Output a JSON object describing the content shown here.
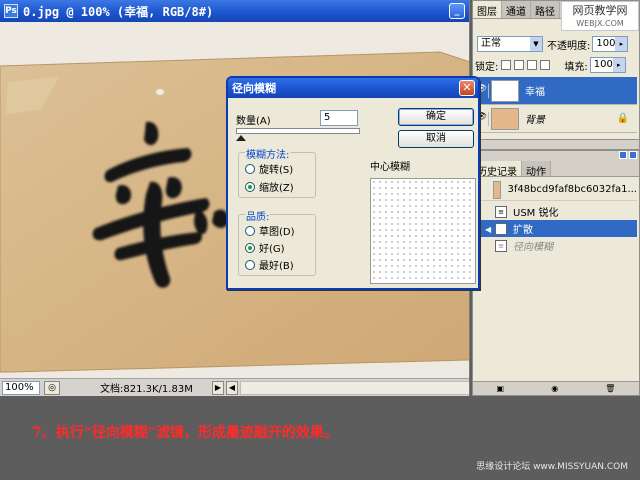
{
  "document": {
    "title": "0.jpg @ 100% (幸福, RGB/8#)",
    "zoom": "100%",
    "status_info": "文档:821.3K/1.83M",
    "canvas_character": "幸"
  },
  "layers_panel": {
    "tabs": [
      "图层",
      "通道",
      "路径"
    ],
    "blend_mode": "正常",
    "opacity_label": "不透明度:",
    "opacity_value": "100%",
    "lock_label": "锁定:",
    "fill_label": "填充:",
    "fill_value": "100%",
    "layers": [
      {
        "name": "幸福"
      },
      {
        "name": "背景"
      }
    ]
  },
  "site_badge": {
    "cn": "网页教学网",
    "en": "WEBJX.COM"
  },
  "history_panel": {
    "tabs": [
      "历史记录",
      "动作"
    ],
    "snapshot_name": "3f48bcd9faf8bc6032fa1...",
    "items": [
      "USM 锐化",
      "扩散",
      "径向模糊"
    ]
  },
  "dialog": {
    "title": "径向模糊",
    "amount_label": "数量(A)",
    "amount_value": "5",
    "ok_label": "确定",
    "cancel_label": "取消",
    "method_title": "模糊方法:",
    "methods": [
      "旋转(S)",
      "缩放(Z)"
    ],
    "selected_method": "缩放(Z)",
    "quality_title": "品质:",
    "qualities": [
      "草图(D)",
      "好(G)",
      "最好(B)"
    ],
    "selected_quality": "好(G)",
    "center_label": "中心模糊"
  },
  "caption": "7、执行“径向模糊”滤镜，形成墨迹融开的效果。",
  "watermark": "思缘设计论坛 www.MISSYUAN.COM",
  "colors": {
    "titlebar_blue": "#1c56cf",
    "selection_blue": "#316ac5",
    "caption_red": "#ff2b2b",
    "paper": "#d8b78a"
  }
}
